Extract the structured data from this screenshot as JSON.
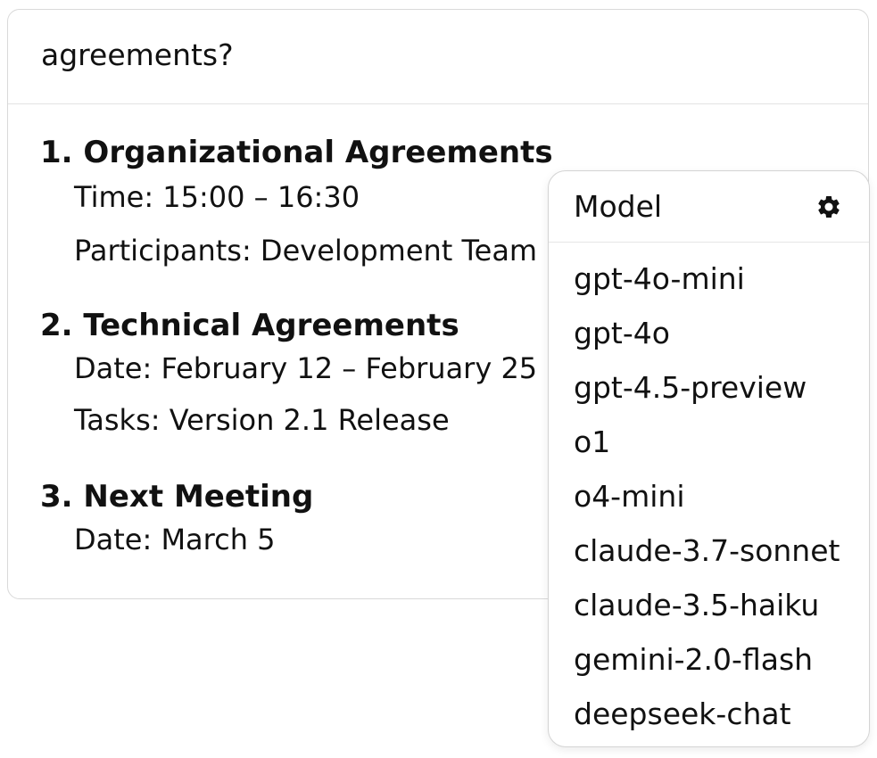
{
  "question": "agreements?",
  "answer": {
    "sections": [
      {
        "title": "1. Organizational Agreements",
        "details": [
          "Time: 15:00 – 16:30",
          "Participants: Development Team"
        ]
      },
      {
        "title": "2. Technical Agreements",
        "details": [
          "Date: February 12 – February 25",
          "Tasks: Version 2.1 Release"
        ]
      },
      {
        "title": "3. Next Meeting",
        "details": [
          "Date: March 5"
        ]
      }
    ]
  },
  "model_menu": {
    "title": "Model",
    "settings_icon": "gear-icon",
    "options": [
      "gpt-4o-mini",
      "gpt-4o",
      "gpt-4.5-preview",
      "o1",
      "o4-mini",
      "claude-3.7-sonnet",
      "claude-3.5-haiku",
      "gemini-2.0-flash",
      "deepseek-chat"
    ]
  }
}
